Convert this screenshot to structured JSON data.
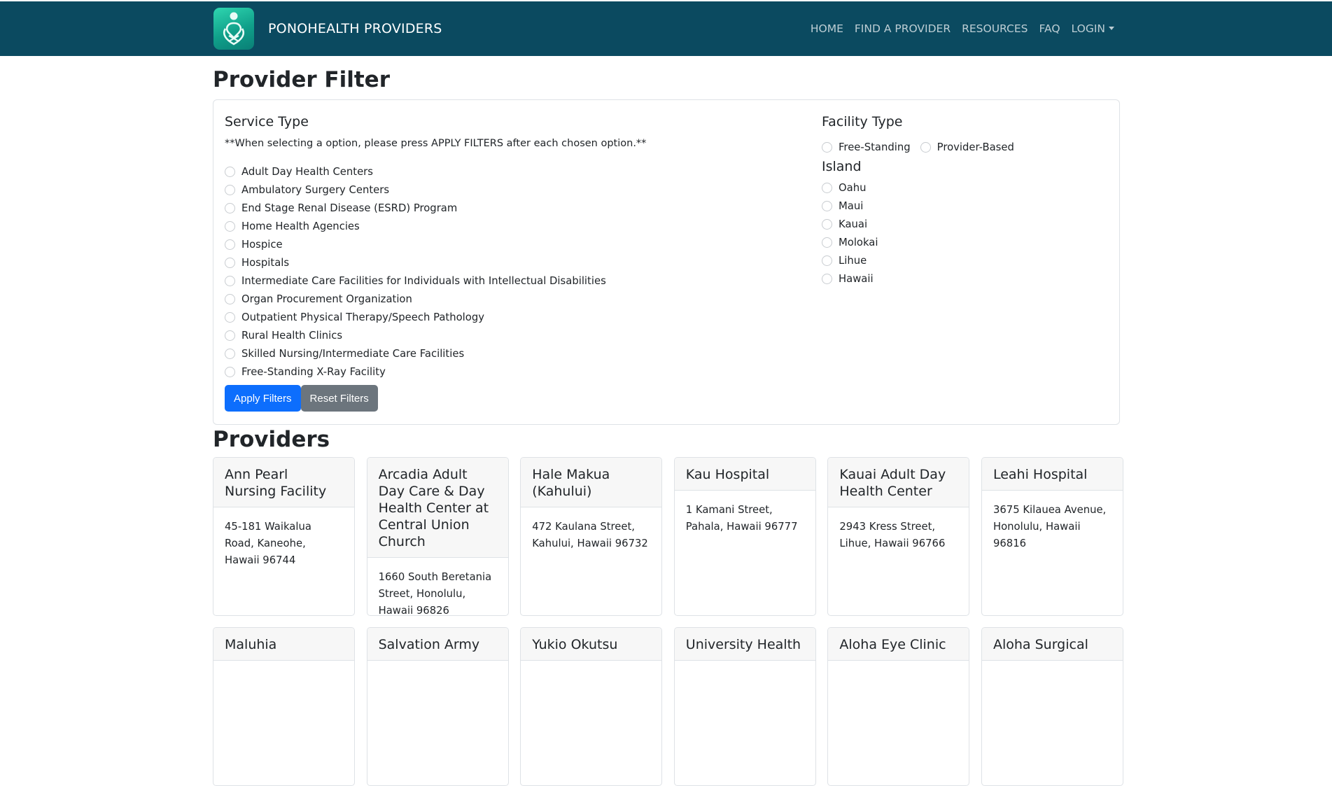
{
  "navbar": {
    "brand": "PONOHEALTH PROVIDERS",
    "links": [
      "HOME",
      "FIND A PROVIDER",
      "RESOURCES",
      "FAQ",
      "LOGIN"
    ]
  },
  "filter": {
    "title": "Provider Filter",
    "service_type": {
      "title": "Service Type",
      "note": "**When selecting a option, please press APPLY FILTERS after each chosen option.**",
      "options": [
        "Adult Day Health Centers",
        "Ambulatory Surgery Centers",
        "End Stage Renal Disease (ESRD) Program",
        "Home Health Agencies",
        "Hospice",
        "Hospitals",
        "Intermediate Care Facilities for Individuals with Intellectual Disabilities",
        "Organ Procurement Organization",
        "Outpatient Physical Therapy/Speech Pathology",
        "Rural Health Clinics",
        "Skilled Nursing/Intermediate Care Facilities",
        "Free-Standing X-Ray Facility"
      ]
    },
    "facility_type": {
      "title": "Facility Type",
      "options": [
        "Free-Standing",
        "Provider-Based"
      ]
    },
    "island": {
      "title": "Island",
      "options": [
        "Oahu",
        "Maui",
        "Kauai",
        "Molokai",
        "Lihue",
        "Hawaii"
      ]
    },
    "apply_label": "Apply Filters",
    "reset_label": "Reset Filters"
  },
  "providers": {
    "title": "Providers",
    "cards": [
      {
        "name": "Ann Pearl Nursing Facility",
        "address": "45-181 Waikalua Road, Kaneohe, Hawaii 96744"
      },
      {
        "name": "Arcadia Adult Day Care & Day Health Center at Central Union Church",
        "address": "1660 South Beretania Street, Honolulu, Hawaii 96826"
      },
      {
        "name": "Hale Makua (Kahului)",
        "address": "472 Kaulana Street, Kahului, Hawaii 96732"
      },
      {
        "name": "Kau Hospital",
        "address": "1 Kamani Street, Pahala, Hawaii 96777"
      },
      {
        "name": "Kauai Adult Day Health Center",
        "address": "2943 Kress Street, Lihue, Hawaii 96766"
      },
      {
        "name": "Leahi Hospital",
        "address": "3675 Kilauea Avenue, Honolulu, Hawaii 96816"
      },
      {
        "name": "Maluhia",
        "address": ""
      },
      {
        "name": "Salvation Army",
        "address": ""
      },
      {
        "name": "Yukio Okutsu",
        "address": ""
      },
      {
        "name": "University Health",
        "address": ""
      },
      {
        "name": "Aloha Eye Clinic",
        "address": ""
      },
      {
        "name": "Aloha Surgical",
        "address": ""
      }
    ]
  }
}
